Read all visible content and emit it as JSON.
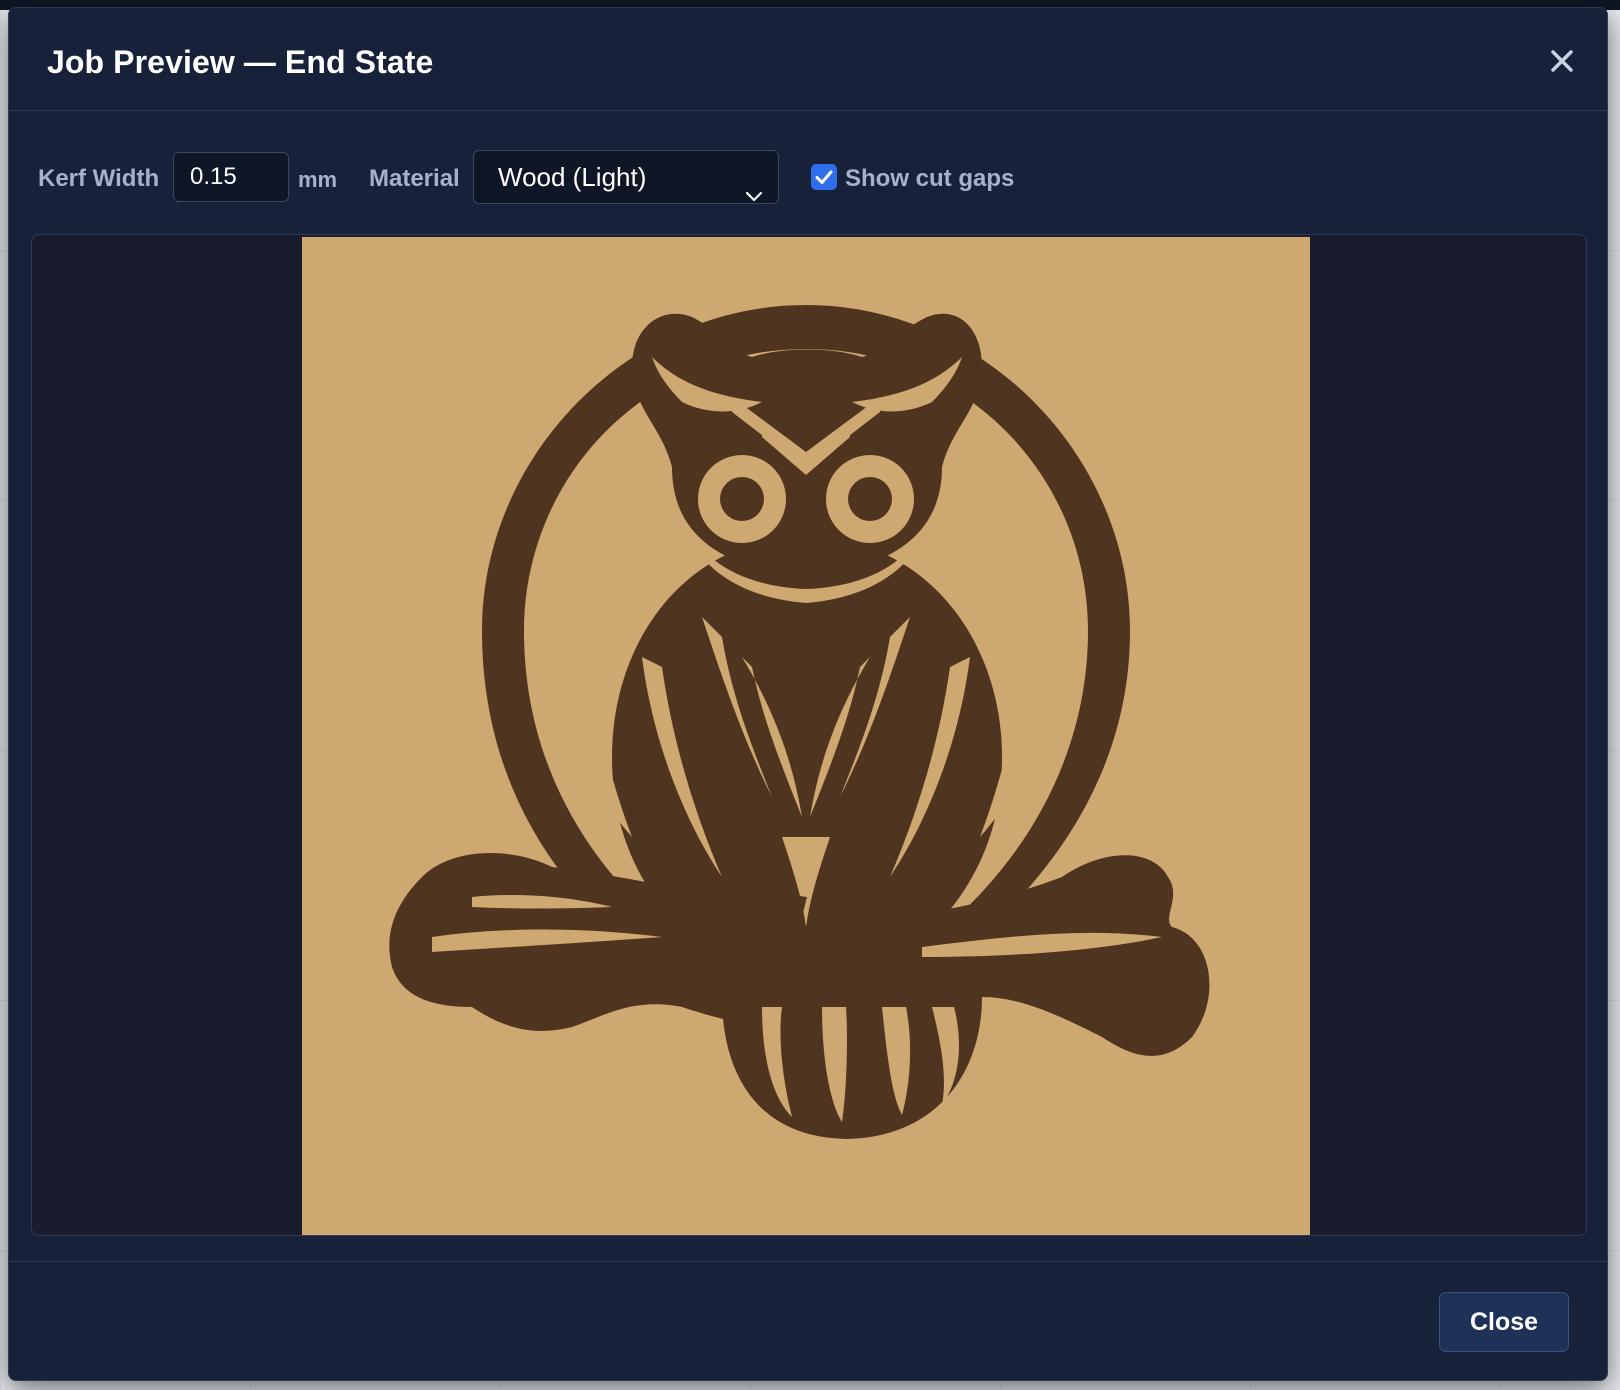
{
  "dialog": {
    "title": "Job Preview — End State",
    "close_icon": "close-icon"
  },
  "toolbar": {
    "kerf_label": "Kerf Width",
    "kerf_value": "0.15",
    "kerf_unit": "mm",
    "material_label": "Material",
    "material_selected": "Wood (Light)",
    "show_cut_gaps_label": "Show cut gaps",
    "show_cut_gaps_checked": true
  },
  "preview": {
    "canvas_background": "#191c2e",
    "material_color": "#cda871",
    "engrave_color": "#4f3520",
    "subject": "owl-on-branch-engraving"
  },
  "footer": {
    "close_label": "Close"
  },
  "colors": {
    "modal_bg": "#172139",
    "accent": "#2f6fec",
    "text_muted": "#a7b2c8"
  }
}
